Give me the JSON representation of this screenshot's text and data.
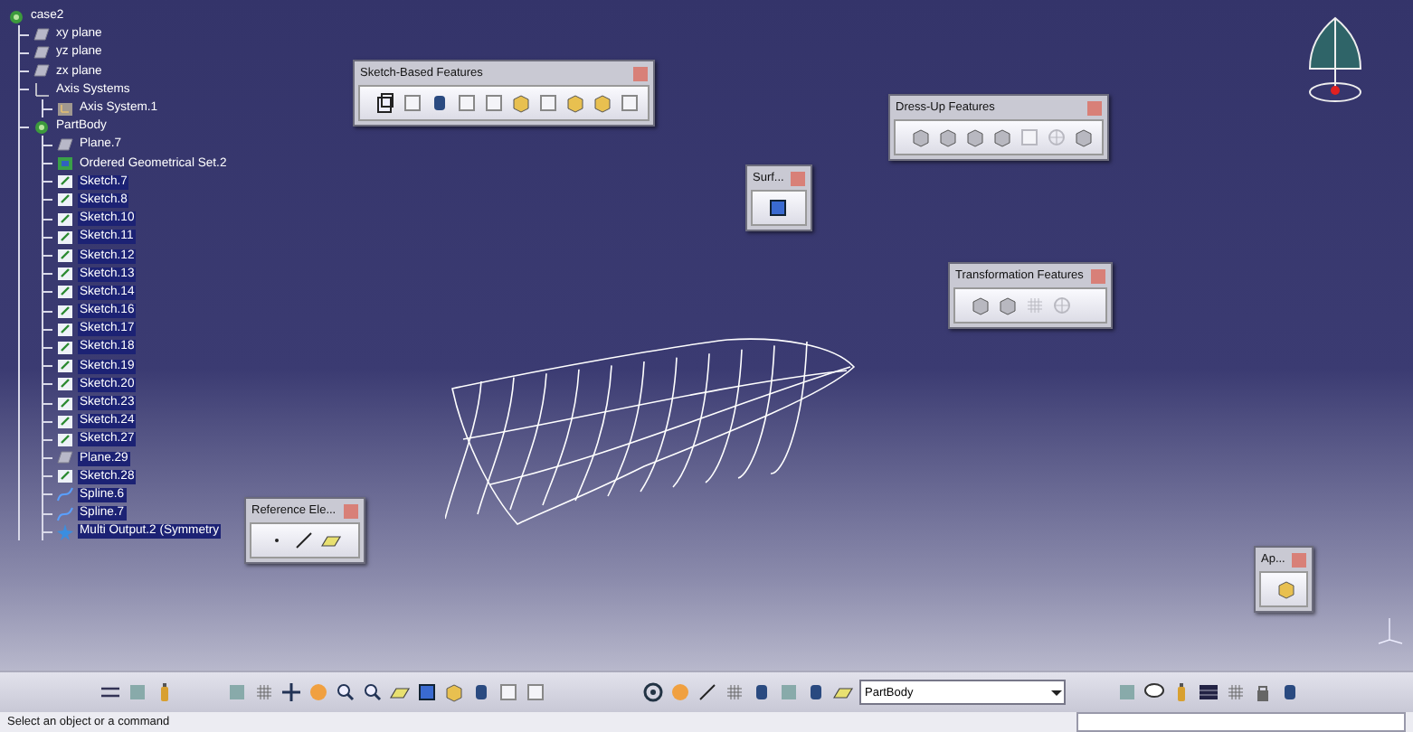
{
  "tree": {
    "label": "case2",
    "kind": "part",
    "selected": false,
    "children": [
      {
        "label": "xy plane",
        "kind": "plane",
        "selected": false
      },
      {
        "label": "yz plane",
        "kind": "plane",
        "selected": false
      },
      {
        "label": "zx plane",
        "kind": "plane",
        "selected": false
      },
      {
        "label": "Axis Systems",
        "kind": "axes",
        "selected": false,
        "children": [
          {
            "label": "Axis System.1",
            "kind": "axis",
            "selected": false
          }
        ]
      },
      {
        "label": "PartBody",
        "kind": "body",
        "selected": false,
        "children": [
          {
            "label": "Plane.7",
            "kind": "plane",
            "selected": false
          },
          {
            "label": "Ordered Geometrical Set.2",
            "kind": "set",
            "selected": false
          },
          {
            "label": "Sketch.7",
            "kind": "sketch",
            "selected": true
          },
          {
            "label": "Sketch.8",
            "kind": "sketch",
            "selected": true
          },
          {
            "label": "Sketch.10",
            "kind": "sketch",
            "selected": true
          },
          {
            "label": "Sketch.11",
            "kind": "sketch",
            "selected": true
          },
          {
            "label": "Sketch.12",
            "kind": "sketch",
            "selected": true
          },
          {
            "label": "Sketch.13",
            "kind": "sketch",
            "selected": true
          },
          {
            "label": "Sketch.14",
            "kind": "sketch",
            "selected": true
          },
          {
            "label": "Sketch.16",
            "kind": "sketch",
            "selected": true
          },
          {
            "label": "Sketch.17",
            "kind": "sketch",
            "selected": true
          },
          {
            "label": "Sketch.18",
            "kind": "sketch",
            "selected": true
          },
          {
            "label": "Sketch.19",
            "kind": "sketch",
            "selected": true
          },
          {
            "label": "Sketch.20",
            "kind": "sketch",
            "selected": true
          },
          {
            "label": "Sketch.23",
            "kind": "sketch",
            "selected": true
          },
          {
            "label": "Sketch.24",
            "kind": "sketch",
            "selected": true
          },
          {
            "label": "Sketch.27",
            "kind": "sketch",
            "selected": true
          },
          {
            "label": "Plane.29",
            "kind": "plane",
            "selected": true
          },
          {
            "label": "Sketch.28",
            "kind": "sketch",
            "selected": true
          },
          {
            "label": "Spline.6",
            "kind": "spline",
            "selected": true
          },
          {
            "label": "Spline.7",
            "kind": "spline",
            "selected": true
          },
          {
            "label": "Multi Output.2 (Symmetry",
            "kind": "multi",
            "selected": true
          }
        ]
      }
    ]
  },
  "toolbars": [
    {
      "title": "Sketch-Based Features",
      "kind": "sketch"
    },
    {
      "title": "Dress-Up Features",
      "kind": "dressup"
    },
    {
      "title": "Surf...",
      "kind": "surface"
    },
    {
      "title": "Transformation Features",
      "kind": "transform"
    },
    {
      "title": "Reference Ele...",
      "kind": "reference"
    },
    {
      "title": "Ap...",
      "kind": "apply"
    }
  ],
  "bottom_toolbar": {
    "dropdown": "PartBody"
  },
  "status_bar": {
    "message": "Select an object or a command"
  }
}
